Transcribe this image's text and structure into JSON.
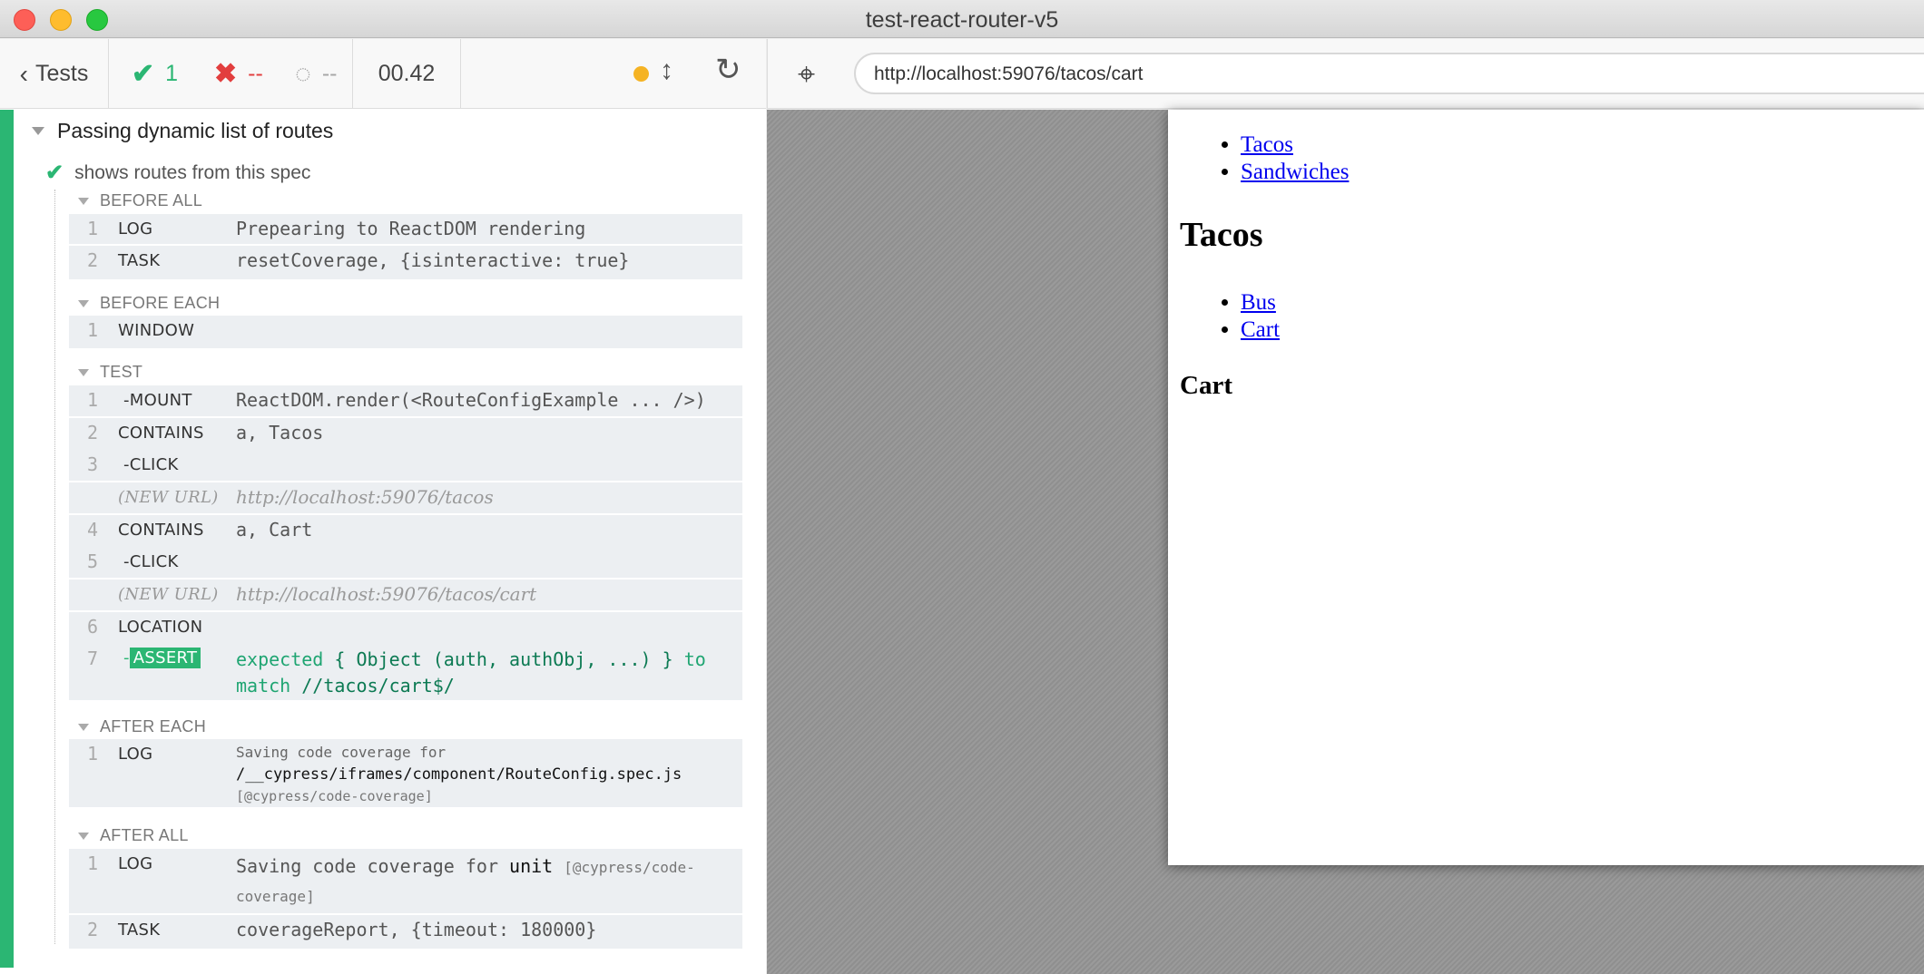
{
  "window": {
    "title": "test-react-router-v5"
  },
  "reporter": {
    "back_label": "Tests",
    "passed": "1",
    "failed": "--",
    "pending": "--",
    "duration": "00.42",
    "suite_title": "Passing dynamic list of routes",
    "test_title": "shows routes from this spec",
    "hooks": {
      "before_all": {
        "label": "BEFORE ALL",
        "rows": [
          {
            "num": "1",
            "name": "LOG",
            "msg": "Prepearing to ReactDOM rendering"
          },
          {
            "num": "2",
            "name": "TASK",
            "msg": "resetCoverage, {isinteractive: true}"
          }
        ]
      },
      "before_each": {
        "label": "BEFORE EACH",
        "rows": [
          {
            "num": "1",
            "name": "WINDOW",
            "msg": ""
          }
        ]
      },
      "test": {
        "label": "TEST",
        "rows": [
          {
            "num": "1",
            "name": "-MOUNT",
            "msg": "ReactDOM.render(<RouteConfigExample ... />)"
          },
          {
            "num": "2",
            "name": "CONTAINS",
            "msg": "a, Tacos"
          },
          {
            "num": "3",
            "name": "-CLICK",
            "msg": ""
          },
          {
            "num": "",
            "name": "(NEW URL)",
            "msg": "http://localhost:59076/tacos"
          },
          {
            "num": "4",
            "name": "CONTAINS",
            "msg": "a, Cart"
          },
          {
            "num": "5",
            "name": "-CLICK",
            "msg": ""
          },
          {
            "num": "",
            "name": "(NEW URL)",
            "msg": "http://localhost:59076/tacos/cart"
          },
          {
            "num": "6",
            "name": "LOCATION",
            "msg": ""
          },
          {
            "num": "7",
            "name_prefix": "-",
            "name": "ASSERT",
            "msg_a": "expected",
            "msg_b": "{ Object (auth, authObj, ...) }",
            "msg_c": "to",
            "msg_d": "match",
            "msg_e": "//tacos/cart$/"
          }
        ]
      },
      "after_each": {
        "label": "AFTER EACH",
        "rows": [
          {
            "num": "1",
            "name": "LOG",
            "line1": "Saving code coverage for",
            "line2": "/__cypress/iframes/component/RouteConfig.spec.js",
            "line3": "[@cypress/code-coverage]"
          }
        ]
      },
      "after_all": {
        "label": "AFTER ALL",
        "rows": [
          {
            "num": "1",
            "name": "LOG",
            "msg_a": "Saving code coverage for",
            "msg_b": "unit",
            "msg_c": "[@cypress/code-",
            "msg_d": "coverage]"
          },
          {
            "num": "2",
            "name": "TASK",
            "msg": "coverageReport, {timeout: 180000}"
          }
        ]
      }
    }
  },
  "aut": {
    "url": "http://localhost:59076/tacos/cart",
    "nav_links": [
      "Tacos",
      "Sandwiches"
    ],
    "heading": "Tacos",
    "sub_links": [
      "Bus",
      "Cart"
    ],
    "subheading": "Cart"
  },
  "colors": {
    "pass": "#2bb673",
    "fail": "#e23e3e",
    "link": "#0000ee",
    "auto_scroll": "#f5b324"
  }
}
